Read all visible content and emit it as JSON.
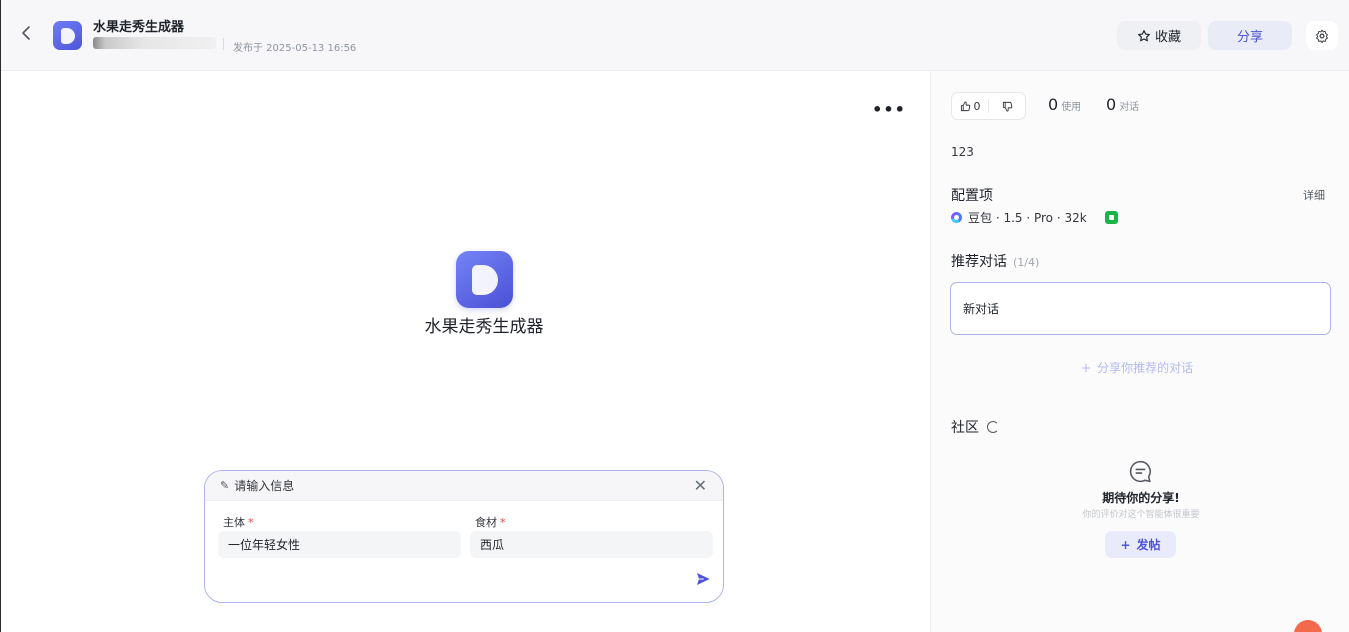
{
  "header": {
    "back_icon": "chevron-left-icon",
    "app_title": "水果走秀生成器",
    "publish_time": "发布于 2025-05-13 16:56",
    "favorite_label": "收藏",
    "share_label": "分享",
    "settings_icon": "gear-icon"
  },
  "main": {
    "more_label": "•••",
    "app_name": "水果走秀生成器",
    "form": {
      "title": "请输入信息",
      "fields": [
        {
          "label": "主体",
          "required_mark": "*",
          "value": "一位年轻女性"
        },
        {
          "label": "食材",
          "required_mark": "*",
          "value": "西瓜"
        }
      ]
    }
  },
  "panel": {
    "likes": "0",
    "uses_count": "0",
    "uses_label": "使用",
    "chats_count": "0",
    "chats_label": "对话",
    "description": "123",
    "config_title": "配置项",
    "detail_label": "详细",
    "model_text": "豆包 · 1.5 · Pro · 32k",
    "recommend_title": "推荐对话",
    "recommend_count": "(1/4)",
    "recommend_items": [
      "新对话"
    ],
    "share_recommend_label": "分享你推荐的对话",
    "community_title": "社区",
    "empty_title": "期待你的分享!",
    "empty_subtitle": "你的评价对这个智能体很重要",
    "post_label": "发帖"
  },
  "colors": {
    "accent": "#4d55d9",
    "card_border": "#aeb3ea",
    "required": "#e54545",
    "plugin_green": "#19b347"
  }
}
